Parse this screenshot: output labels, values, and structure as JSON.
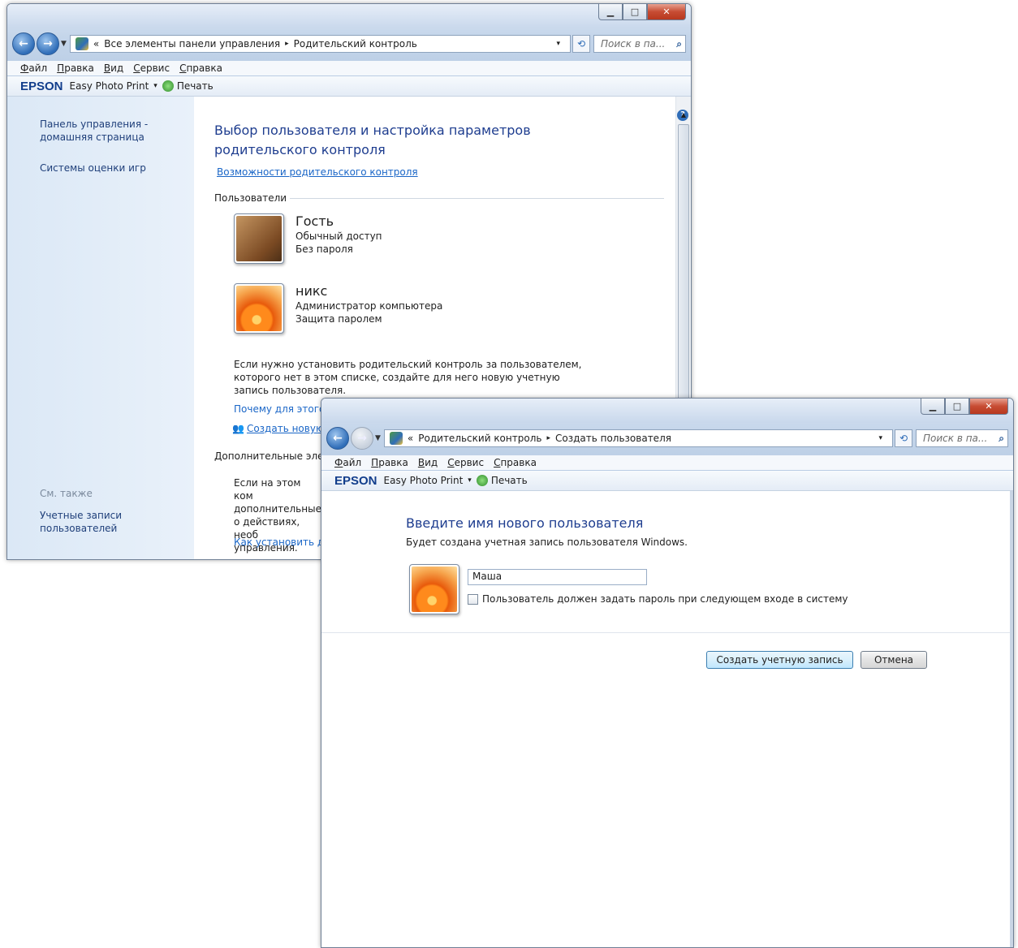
{
  "window1": {
    "address": {
      "prefix": "«",
      "crumb1": "Все элементы панели управления",
      "arrow": "▸",
      "crumb2": "Родительский контроль",
      "dropdown": "▾"
    },
    "search_placeholder": "Поиск в па...",
    "menu": [
      "Файл",
      "Правка",
      "Вид",
      "Сервис",
      "Справка"
    ],
    "toolbar": {
      "brand": "EPSON",
      "app": "Easy Photo Print",
      "dropdown": "▾",
      "print": "Печать"
    },
    "nav": {
      "home": "Панель управления - домашняя страница",
      "games": "Системы оценки игр",
      "see_also": "См. также",
      "accounts": "Учетные записи пользователей"
    },
    "main": {
      "title": "Выбор пользователя и настройка параметров родительского контроля",
      "features_link": "Возможности родительского контроля",
      "users_group": "Пользователи",
      "users": [
        {
          "name": "Гость",
          "line1": "Обычный доступ",
          "line2": "Без пароля"
        },
        {
          "name": "никс",
          "line1": "Администратор компьютера",
          "line2": "Защита паролем"
        }
      ],
      "info": "Если нужно установить родительский контроль за пользователем, которого нет в этом списке, создайте для него новую учетную запись пользователя.",
      "why_link": "Почему для этого",
      "create_link": "Создать новую",
      "extra_group": "Дополнительные эле",
      "extra_text": "Если на этом ком дополнительные о действиях, необ управления.",
      "how_link": "Как установить до"
    }
  },
  "window2": {
    "address": {
      "prefix": "«",
      "crumb1": "Родительский контроль",
      "arrow": "▸",
      "crumb2": "Создать пользователя",
      "dropdown": "▾"
    },
    "search_placeholder": "Поиск в па...",
    "menu": [
      "Файл",
      "Правка",
      "Вид",
      "Сервис",
      "Справка"
    ],
    "toolbar": {
      "brand": "EPSON",
      "app": "Easy Photo Print",
      "dropdown": "▾",
      "print": "Печать"
    },
    "title": "Введите имя нового пользователя",
    "subtitle": "Будет создана учетная запись пользователя Windows.",
    "username_value": "Маша",
    "checkbox_label": "Пользователь должен задать пароль при следующем входе в систему",
    "create_button": "Создать учетную запись",
    "cancel_button": "Отмена"
  },
  "colors": {
    "accent_blue": "#1e3d8f",
    "link": "#1a66c7",
    "close_red": "#c74c33"
  }
}
